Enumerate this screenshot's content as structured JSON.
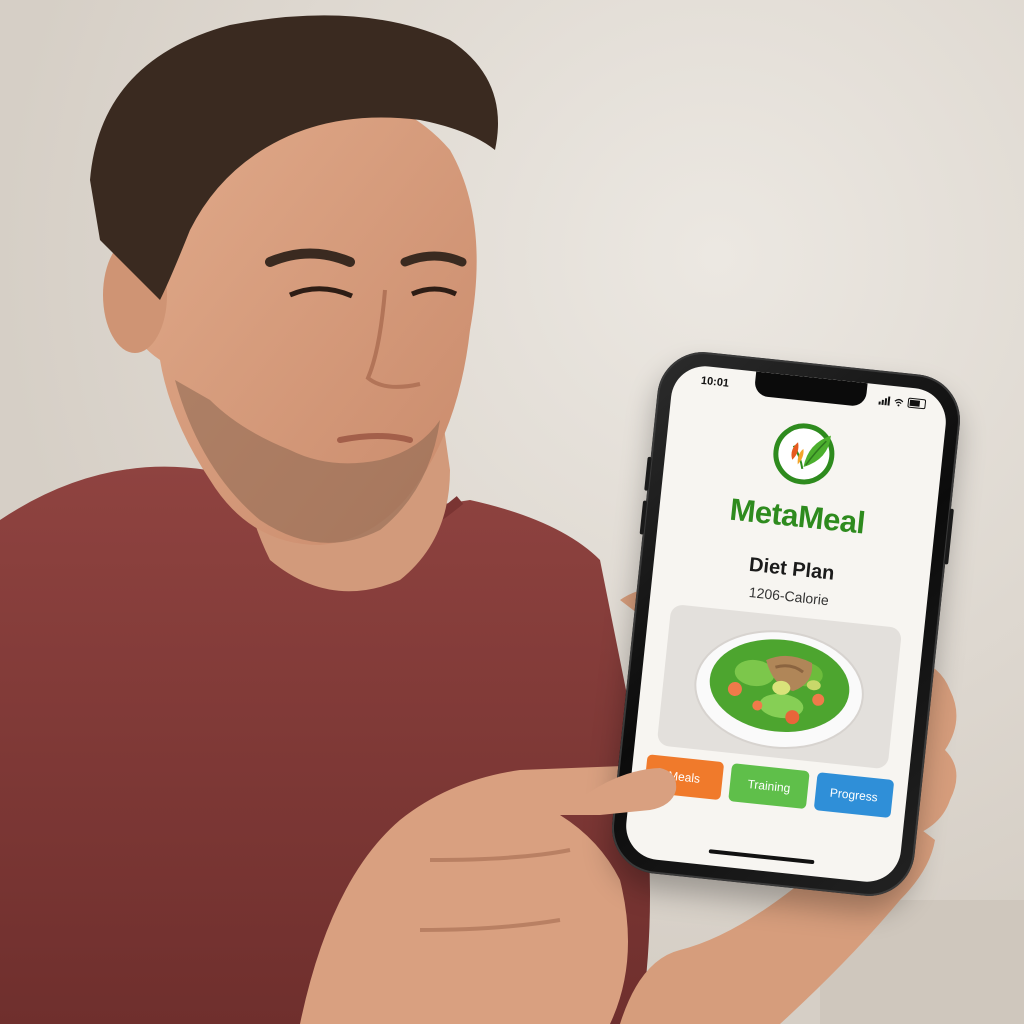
{
  "phone": {
    "status_time": "10:01",
    "app_name": "MetaMeal",
    "plan_title": "Diet Plan",
    "plan_subtitle": "1206-Calorie",
    "meal_image": "salad-bowl",
    "buttons": [
      {
        "label": "Meals",
        "color": "#f07a2b"
      },
      {
        "label": "Training",
        "color": "#5fbf4a"
      },
      {
        "label": "Progress",
        "color": "#2f8fd8"
      }
    ]
  },
  "colors": {
    "brand_green": "#2e8b1e",
    "wall": "#e3ded7",
    "shirt": "#8a3d3a"
  }
}
